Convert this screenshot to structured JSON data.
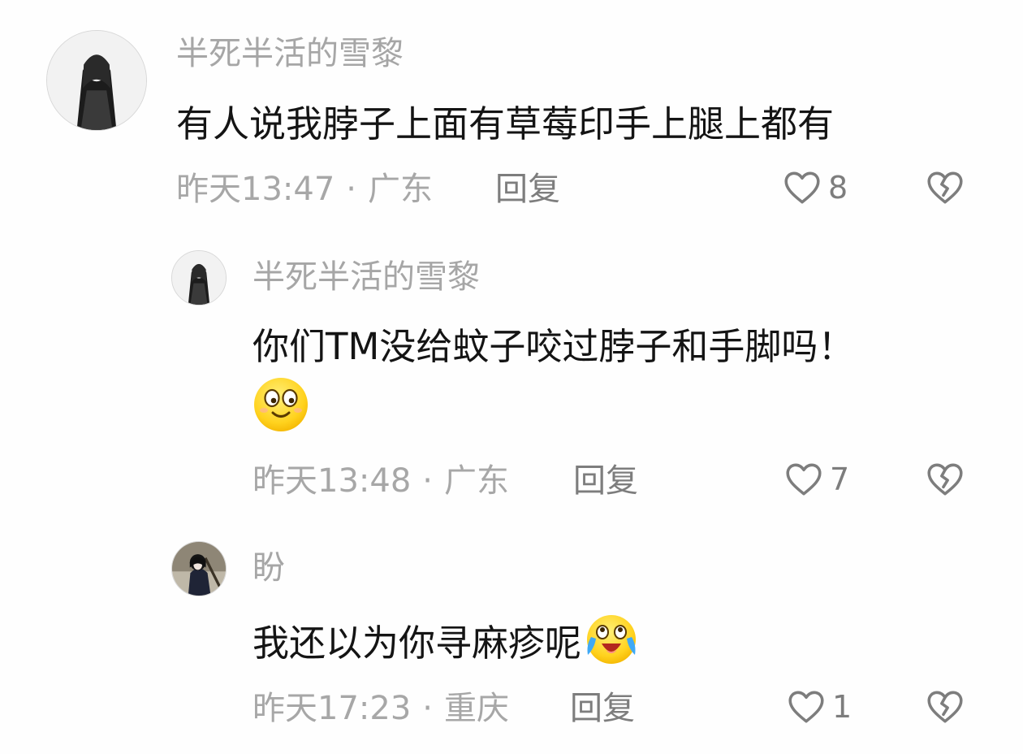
{
  "comments": [
    {
      "username": "半死半活的雪黎",
      "text": "有人说我脖子上面有草莓印手上腿上都有",
      "time": "昨天13:47",
      "location": "广东",
      "reply_label": "回复",
      "likes": "8"
    },
    {
      "username": "半死半活的雪黎",
      "text": "你们TM没给蚊子咬过脖子和手脚吗！",
      "emoji": "smiling-face-emoji",
      "time": "昨天13:48",
      "location": "广东",
      "reply_label": "回复",
      "likes": "7"
    },
    {
      "username": "盼",
      "text": "我还以为你寻麻疹呢",
      "emoji": "crying-laughing-face-emoji",
      "time": "昨天17:23",
      "location": "重庆",
      "reply_label": "回复",
      "likes": "1"
    }
  ],
  "separator": "·",
  "icons": {
    "like": "heart-outline-icon",
    "dislike": "broken-heart-icon"
  },
  "colors": {
    "username": "#a6a6a6",
    "text": "#141414",
    "meta": "#a7a7a7",
    "reply": "#7d7d7d",
    "background": "#fefefe"
  }
}
